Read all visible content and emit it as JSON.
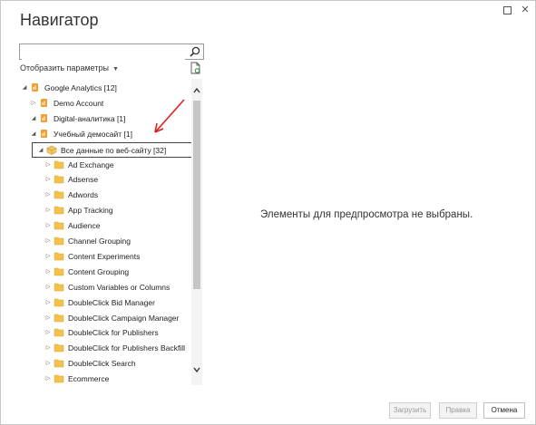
{
  "window": {
    "title": "Навигатор",
    "maximize_label": "",
    "close_label": "✕"
  },
  "search": {
    "placeholder": "",
    "value": ""
  },
  "options": {
    "label": "Отобразить параметры",
    "caret": "▼"
  },
  "tree": {
    "items": [
      {
        "label": "Google Analytics [12]",
        "level": 0,
        "expander": "◢",
        "icon": "analytics-icon"
      },
      {
        "label": "Demo Account",
        "level": 1,
        "expander": "▷",
        "icon": "analytics-icon"
      },
      {
        "label": "Digital-аналитика [1]",
        "level": 1,
        "expander": "◢",
        "icon": "analytics-icon"
      },
      {
        "label": "Учебный демосайт [1]",
        "level": 2,
        "expander": "◢",
        "icon": "analytics-icon"
      },
      {
        "label": "Все данные по веб-сайту [32]",
        "level": 3,
        "expander": "◢",
        "icon": "cube-icon"
      },
      {
        "label": "Ad Exchange",
        "level": 4,
        "expander": "▷",
        "icon": "folder-icon"
      },
      {
        "label": "Adsense",
        "level": 4,
        "expander": "▷",
        "icon": "folder-icon"
      },
      {
        "label": "Adwords",
        "level": 4,
        "expander": "▷",
        "icon": "folder-icon"
      },
      {
        "label": "App Tracking",
        "level": 4,
        "expander": "▷",
        "icon": "folder-icon"
      },
      {
        "label": "Audience",
        "level": 4,
        "expander": "▷",
        "icon": "folder-icon"
      },
      {
        "label": "Channel Grouping",
        "level": 4,
        "expander": "▷",
        "icon": "folder-icon"
      },
      {
        "label": "Content Experiments",
        "level": 4,
        "expander": "▷",
        "icon": "folder-icon"
      },
      {
        "label": "Content Grouping",
        "level": 4,
        "expander": "▷",
        "icon": "folder-icon"
      },
      {
        "label": "Custom Variables or Columns",
        "level": 4,
        "expander": "▷",
        "icon": "folder-icon"
      },
      {
        "label": "DoubleClick Bid Manager",
        "level": 4,
        "expander": "▷",
        "icon": "folder-icon"
      },
      {
        "label": "DoubleClick Campaign Manager",
        "level": 4,
        "expander": "▷",
        "icon": "folder-icon"
      },
      {
        "label": "DoubleClick for Publishers",
        "level": 4,
        "expander": "▷",
        "icon": "folder-icon"
      },
      {
        "label": "DoubleClick for Publishers Backfill",
        "level": 4,
        "expander": "▷",
        "icon": "folder-icon"
      },
      {
        "label": "DoubleClick Search",
        "level": 4,
        "expander": "▷",
        "icon": "folder-icon"
      },
      {
        "label": "Ecommerce",
        "level": 4,
        "expander": "▷",
        "icon": "folder-icon"
      }
    ]
  },
  "scrollbar": {
    "up": "⌃",
    "down": "⌄"
  },
  "preview": {
    "empty_message": "Элементы для предпросмотра не выбраны."
  },
  "buttons": {
    "load": "Загрузить",
    "edit": "Правка",
    "cancel": "Отмена"
  },
  "colors": {
    "annotation_arrow": "#e02020",
    "folder": "#f2c14e",
    "analytics": "#f0a030"
  }
}
